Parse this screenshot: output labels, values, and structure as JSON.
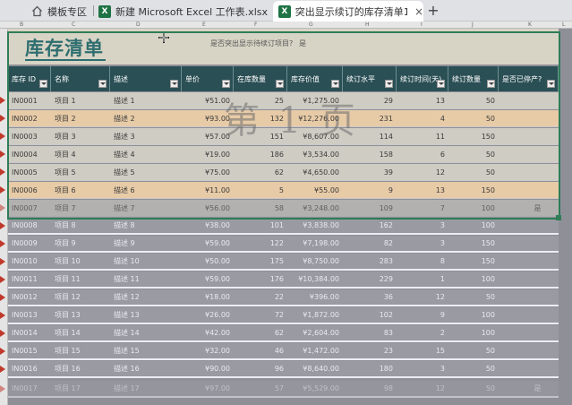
{
  "tabs": [
    {
      "label": "模板专区",
      "icon": "home-icon"
    },
    {
      "label": "新建 Microsoft Excel 工作表.xlsx",
      "icon": "excel-icon"
    },
    {
      "label": "突出显示续订的库存清单1",
      "icon": "excel-icon",
      "active": true
    }
  ],
  "tab_close": "×",
  "tab_new": "+",
  "excel_icon_letter": "X",
  "column_letters": [
    "B",
    "C",
    "D",
    "E",
    "F",
    "G",
    "H",
    "I",
    "J",
    "K",
    "L"
  ],
  "sheet": {
    "title": "库存清单",
    "question": "是否突出显示待续订项目?",
    "answer": "是",
    "watermark": "第 1 页",
    "headers": [
      "库存 ID",
      "名称",
      "描述",
      "单价",
      "在库数量",
      "库存价值",
      "续订水平",
      "续订时间(天)",
      "续订数量",
      "是否已停产?"
    ],
    "rows": [
      [
        "IN0001",
        "项目 1",
        "描述 1",
        "¥51.00",
        "25",
        "¥1,275.00",
        "29",
        "13",
        "50",
        ""
      ],
      [
        "IN0002",
        "项目 2",
        "描述 2",
        "¥93.00",
        "132",
        "¥12,276.00",
        "231",
        "4",
        "50",
        ""
      ],
      [
        "IN0003",
        "项目 3",
        "描述 3",
        "¥57.00",
        "151",
        "¥8,607.00",
        "114",
        "11",
        "150",
        ""
      ],
      [
        "IN0004",
        "项目 4",
        "描述 4",
        "¥19.00",
        "186",
        "¥3,534.00",
        "158",
        "6",
        "50",
        ""
      ],
      [
        "IN0005",
        "项目 5",
        "描述 5",
        "¥75.00",
        "62",
        "¥4,650.00",
        "39",
        "12",
        "50",
        ""
      ],
      [
        "IN0006",
        "项目 6",
        "描述 6",
        "¥11.00",
        "5",
        "¥55.00",
        "9",
        "13",
        "150",
        ""
      ],
      [
        "IN0007",
        "项目 7",
        "描述 7",
        "¥56.00",
        "58",
        "¥3,248.00",
        "109",
        "7",
        "100",
        "是"
      ],
      [
        "IN0008",
        "项目 8",
        "描述 8",
        "¥38.00",
        "101",
        "¥3,838.00",
        "162",
        "3",
        "100",
        ""
      ],
      [
        "IN0009",
        "项目 9",
        "描述 9",
        "¥59.00",
        "122",
        "¥7,198.00",
        "82",
        "3",
        "150",
        ""
      ],
      [
        "IN0010",
        "项目 10",
        "描述 10",
        "¥50.00",
        "175",
        "¥8,750.00",
        "283",
        "8",
        "150",
        ""
      ],
      [
        "IN0011",
        "项目 11",
        "描述 11",
        "¥59.00",
        "176",
        "¥10,384.00",
        "229",
        "1",
        "100",
        ""
      ],
      [
        "IN0012",
        "项目 12",
        "描述 12",
        "¥18.00",
        "22",
        "¥396.00",
        "36",
        "12",
        "50",
        ""
      ],
      [
        "IN0013",
        "项目 13",
        "描述 13",
        "¥26.00",
        "72",
        "¥1,872.00",
        "102",
        "9",
        "100",
        ""
      ],
      [
        "IN0014",
        "项目 14",
        "描述 14",
        "¥42.00",
        "62",
        "¥2,604.00",
        "83",
        "2",
        "100",
        ""
      ],
      [
        "IN0015",
        "项目 15",
        "描述 15",
        "¥32.00",
        "46",
        "¥1,472.00",
        "23",
        "15",
        "50",
        ""
      ],
      [
        "IN0016",
        "项目 16",
        "描述 16",
        "¥90.00",
        "96",
        "¥8,640.00",
        "180",
        "3",
        "50",
        ""
      ],
      [
        "IN0017",
        "项目 17",
        "描述 17",
        "¥97.00",
        "57",
        "¥5,529.00",
        "98",
        "12",
        "50",
        "是"
      ]
    ],
    "row_styles": [
      "in",
      "hl",
      "in",
      "in",
      "in",
      "hl",
      "in faded",
      "out",
      "out",
      "out",
      "out",
      "out",
      "out",
      "out",
      "out",
      "out",
      "out faded"
    ],
    "flagged_rows": [
      0,
      1,
      2,
      3,
      4,
      5,
      6,
      7,
      8,
      9,
      10,
      11,
      12,
      13,
      14,
      15,
      16
    ],
    "colors": {
      "header_bg": "#2a4f55",
      "title": "#2e6e70",
      "highlight": "#e7cba7",
      "selection": "#2e7d57"
    }
  }
}
